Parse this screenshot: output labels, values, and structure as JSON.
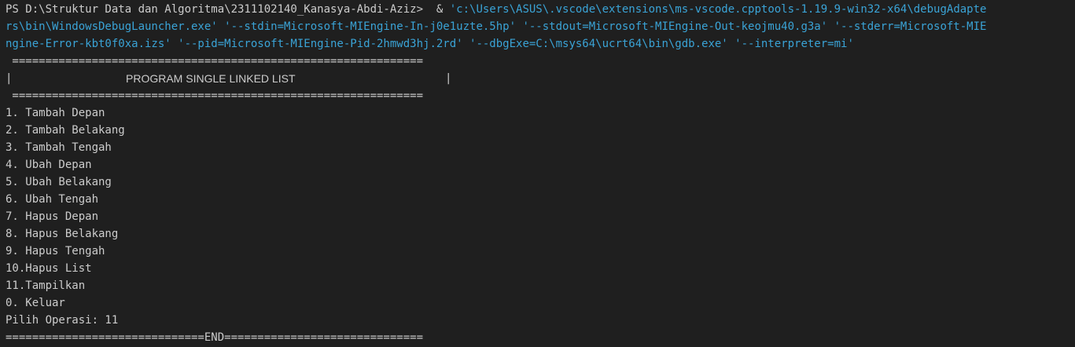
{
  "terminal": {
    "prompt": "PS D:\\Struktur Data dan Algoritma\\2311102140_Kanasya-Abdi-Aziz> ",
    "command_amp": " & ",
    "command_line1": "'c:\\Users\\ASUS\\.vscode\\extensions\\ms-vscode.cpptools-1.19.9-win32-x64\\debugAdapte",
    "command_line2": "rs\\bin\\WindowsDebugLauncher.exe' '--stdin=Microsoft-MIEngine-In-j0e1uzte.5hp' '--stdout=Microsoft-MIEngine-Out-keojmu40.g3a' '--stderr=Microsoft-MIE",
    "command_line3": "ngine-Error-kbt0f0xa.izs' '--pid=Microsoft-MIEngine-Pid-2hmwd3hj.2rd' '--dbgExe=C:\\msys64\\ucrt64\\bin\\gdb.exe' '--interpreter=mi'",
    "separator_top": " ==============================================================",
    "title_pipe_left": "|",
    "title": "PROGRAM SINGLE LINKED LIST",
    "title_pipe_right": "|",
    "separator_bottom": " ==============================================================",
    "menu": [
      "1. Tambah Depan",
      "2. Tambah Belakang",
      "3. Tambah Tengah",
      "4. Ubah Depan",
      "5. Ubah Belakang",
      "6. Ubah Tengah",
      "7. Hapus Depan",
      "8. Hapus Belakang",
      "9. Hapus Tengah",
      "10.Hapus List",
      "11.Tampilkan",
      "0. Keluar"
    ],
    "input_prompt": "Pilih Operasi: 11",
    "end_line": "==============================END=============================="
  },
  "colors": {
    "background": "#1f1f1f",
    "text": "#cccccc",
    "string_blue": "#3aa3d6"
  }
}
